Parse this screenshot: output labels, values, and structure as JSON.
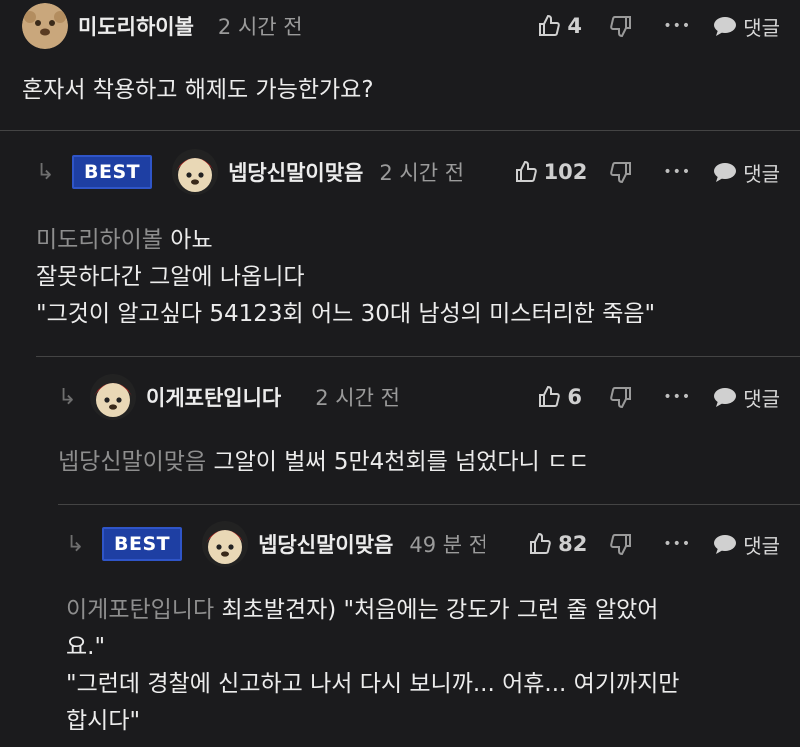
{
  "common": {
    "reply_label": "댓글",
    "more_glyph": "•••"
  },
  "comments": [
    {
      "nickname": "미도리하이볼",
      "time": "2 시간 전",
      "likes": "4",
      "best": "",
      "mention": "",
      "lines": [
        "혼자서 착용하고 해제도 가능한가요?"
      ]
    },
    {
      "nickname": "넵당신말이맞음",
      "time": "2 시간 전",
      "likes": "102",
      "best": "BEST",
      "mention": "미도리하이볼",
      "lines": [
        "아뇨",
        "잘못하다간 그알에 나옵니다",
        "\"그것이 알고싶다 54123회 어느 30대 남성의 미스터리한 죽음\""
      ]
    },
    {
      "nickname": "이게포탄입니다",
      "time": "2 시간 전",
      "likes": "6",
      "best": "",
      "mention": "넵당신말이맞음",
      "lines": [
        "그알이 벌써 5만4천회를 넘었다니 ㄷㄷ"
      ]
    },
    {
      "nickname": "넵당신말이맞음",
      "time": "49 분 전",
      "likes": "82",
      "best": "BEST",
      "mention": "이게포탄입니다",
      "lines": [
        "최초발견자) \"처음에는 강도가 그런 줄 알았어",
        "요.\"",
        "\"그런데 경찰에 신고하고 나서 다시 보니까... 어휴... 여기까지만",
        "합시다\""
      ]
    }
  ]
}
